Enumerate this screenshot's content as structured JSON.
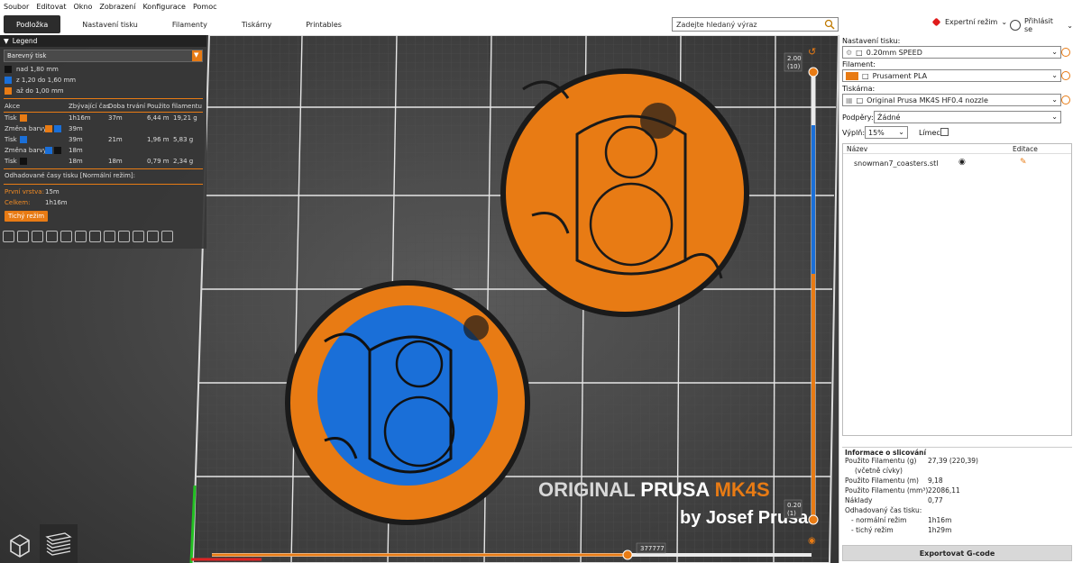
{
  "menu": [
    "Soubor",
    "Editovat",
    "Okno",
    "Zobrazení",
    "Konfigurace",
    "Pomoc"
  ],
  "tabs": [
    {
      "label": "Podložka",
      "active": true
    },
    {
      "label": "Nastavení tisku",
      "active": false
    },
    {
      "label": "Filamenty",
      "active": false
    },
    {
      "label": "Tiskárny",
      "active": false
    },
    {
      "label": "Printables",
      "active": false
    }
  ],
  "search": {
    "placeholder": "Zadejte hledaný výraz"
  },
  "mode": {
    "label": "Expertní režim",
    "color": "#e01b1b"
  },
  "login": {
    "label": "Přihlásit se"
  },
  "legend": {
    "title": "Legend",
    "type_select": "Barevný tisk",
    "ranges": [
      {
        "label": "nad 1,80 mm",
        "color": "#111111"
      },
      {
        "label": "z 1,20 do 1,60 mm",
        "color": "#1a6fd8"
      },
      {
        "label": "až do 1,00 mm",
        "color": "#e87b14"
      }
    ],
    "columns": [
      "Akce",
      "Zbývající čas",
      "Doba trvání",
      "Použito filamentu"
    ],
    "rows": [
      {
        "action": "Tisk",
        "swatches": [
          "#e87b14"
        ],
        "remaining": "1h16m",
        "duration": "37m",
        "length": "6,44 m",
        "weight": "19,21 g"
      },
      {
        "action": "Změna barvy",
        "swatches": [
          "#e87b14",
          "#1a6fd8"
        ],
        "remaining": "39m",
        "duration": "",
        "length": "",
        "weight": ""
      },
      {
        "action": "Tisk",
        "swatches": [
          "#1a6fd8"
        ],
        "remaining": "39m",
        "duration": "21m",
        "length": "1,96 m",
        "weight": "5,83 g"
      },
      {
        "action": "Změna barvy",
        "swatches": [
          "#1a6fd8",
          "#111111"
        ],
        "remaining": "18m",
        "duration": "",
        "length": "",
        "weight": ""
      },
      {
        "action": "Tisk",
        "swatches": [
          "#111111"
        ],
        "remaining": "18m",
        "duration": "18m",
        "length": "0,79 m",
        "weight": "2,34 g"
      }
    ],
    "estimate_title": "Odhadované časy tisku [Normální režim]:",
    "first_layer_label": "První vrstva:",
    "first_layer_value": "15m",
    "total_label": "Celkem:",
    "total_value": "1h16m",
    "quiet_button": "Tichý režim"
  },
  "viewport": {
    "slider_top": "2.00",
    "slider_top_layer": "(10)",
    "slider_bottom": "0.20",
    "slider_bottom_layer": "(1)",
    "h_slider_value": "377777",
    "printer_logo_line1a": "ORIGINAL ",
    "printer_logo_line1b": "PRUSA ",
    "printer_logo_line1c": "MK4S",
    "printer_logo_line2": "by Josef Prusa"
  },
  "settings": {
    "print_label": "Nastavení tisku:",
    "print_value": "0.20mm SPEED",
    "filament_label": "Filament:",
    "filament_value": "Prusament PLA",
    "filament_color": "#e87b14",
    "printer_label": "Tiskárna:",
    "printer_value": "Original Prusa MK4S HF0.4 nozzle",
    "supports_label": "Podpěry:",
    "supports_value": "Žádné",
    "infill_label": "Výplň:",
    "infill_value": "15%",
    "brim_label": "Límec:"
  },
  "objects": {
    "col_name": "Název",
    "col_edit": "Editace",
    "items": [
      "snowman7_coasters.stl"
    ]
  },
  "info": {
    "title": "Informace o slicování",
    "rows": [
      {
        "label": "Použito Filamentu (g)",
        "value": "27,39 (220,39)"
      },
      {
        "label": "(včetně cívky)",
        "value": ""
      },
      {
        "label": "Použito Filamentu (m)",
        "value": "9,18"
      },
      {
        "label": "Použito Filamentu (mm³)",
        "value": "22086,11"
      },
      {
        "label": "Náklady",
        "value": "0,77"
      },
      {
        "label": "Odhadovaný čas tisku:",
        "value": ""
      },
      {
        "label": "- normální režim",
        "value": "1h16m"
      },
      {
        "label": "- tichý režim",
        "value": "1h29m"
      }
    ]
  },
  "export_label": "Exportovat G-code"
}
